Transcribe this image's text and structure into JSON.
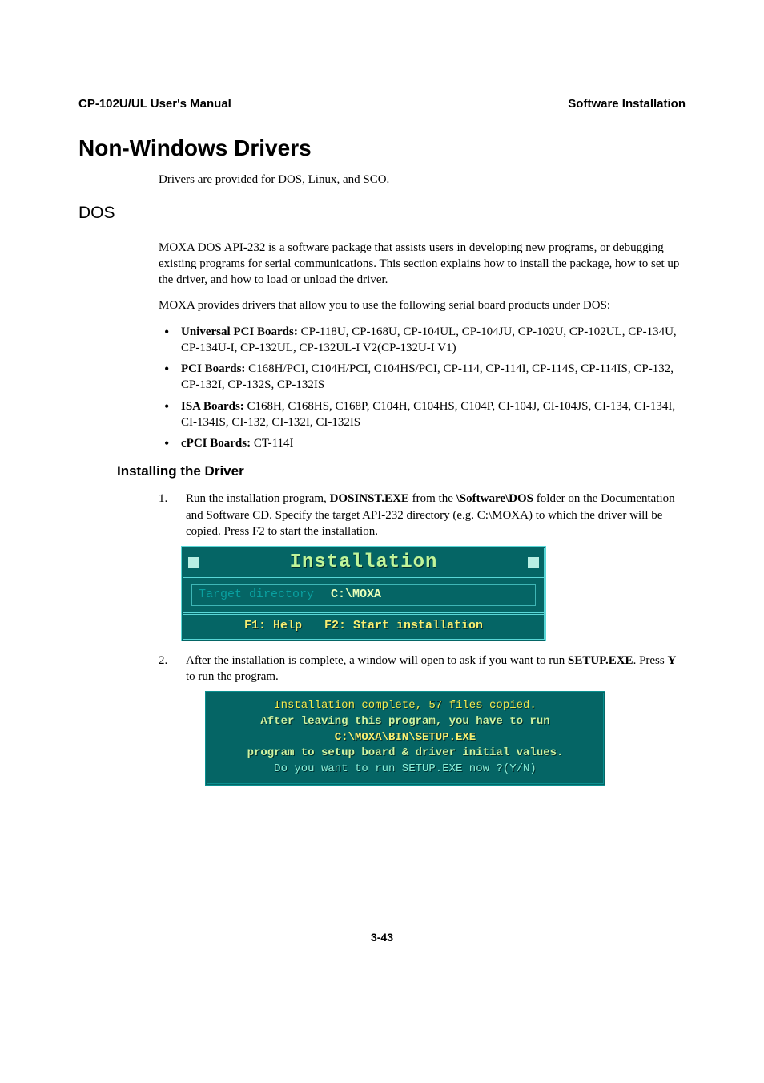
{
  "header": {
    "left": "CP-102U/UL User's Manual",
    "right": "Software Installation"
  },
  "h1": "Non-Windows Drivers",
  "intro": "Drivers are provided for DOS, Linux, and SCO.",
  "h2": "DOS",
  "dos": {
    "p1": "MOXA DOS API-232 is a software package that assists users in developing new programs, or debugging existing programs for serial communications. This section explains how to install the package, how to set up the driver, and how to load or unload the driver.",
    "p2": "MOXA provides drivers that allow you to use the following serial board products under DOS:",
    "bullets": {
      "b1_head": "Universal PCI Boards:",
      "b1_rest": " CP-118U, CP-168U, CP-104UL, CP-104JU, CP-102U, CP-102UL, CP-134U, CP-134U-I, CP-132UL, CP-132UL-I V2(CP-132U-I V1)",
      "b2_head": "PCI Boards:",
      "b2_rest": " C168H/PCI, C104H/PCI, C104HS/PCI, CP-114, CP-114I, CP-114S, CP-114IS, CP-132, CP-132I, CP-132S, CP-132IS",
      "b3_head": "ISA Boards:",
      "b3_rest": " C168H, C168HS, C168P, C104H, C104HS, C104P, CI-104J, CI-104JS, CI-134, CI-134I, CI-134IS, CI-132, CI-132I, CI-132IS",
      "b4_head": "cPCI Boards:",
      "b4_rest": " CT-114I"
    }
  },
  "h3": "Installing the Driver",
  "steps": {
    "s1": {
      "num": "1.",
      "t1": "Run the installation program, ",
      "b1": "DOSINST.EXE",
      "t2": " from the ",
      "b2": "\\Software\\DOS",
      "t3": " folder on the Documentation and Software CD. Specify the target API-232 directory (e.g. C:\\MOXA) to which the driver will be copied. Press F2 to start the installation."
    },
    "s2": {
      "num": "2.",
      "t1": "After the installation is complete, a window will open to ask if you want to run ",
      "b1": "SETUP.EXE",
      "t2": ". Press ",
      "b2": "Y",
      "t3": " to run the program."
    }
  },
  "installer": {
    "title": "Installation",
    "label": "Target directory",
    "value": "C:\\MOXA",
    "f1": "F1: Help",
    "f2": "F2: Start installation"
  },
  "msgbox": {
    "l1": "Installation complete, 57 files copied.",
    "l2": "After leaving this program, you have to run",
    "l3": "C:\\MOXA\\BIN\\SETUP.EXE",
    "l4": "program to setup board & driver initial values.",
    "l5": "Do you want to run SETUP.EXE now ?(Y/N)"
  },
  "page_num": "3-43"
}
